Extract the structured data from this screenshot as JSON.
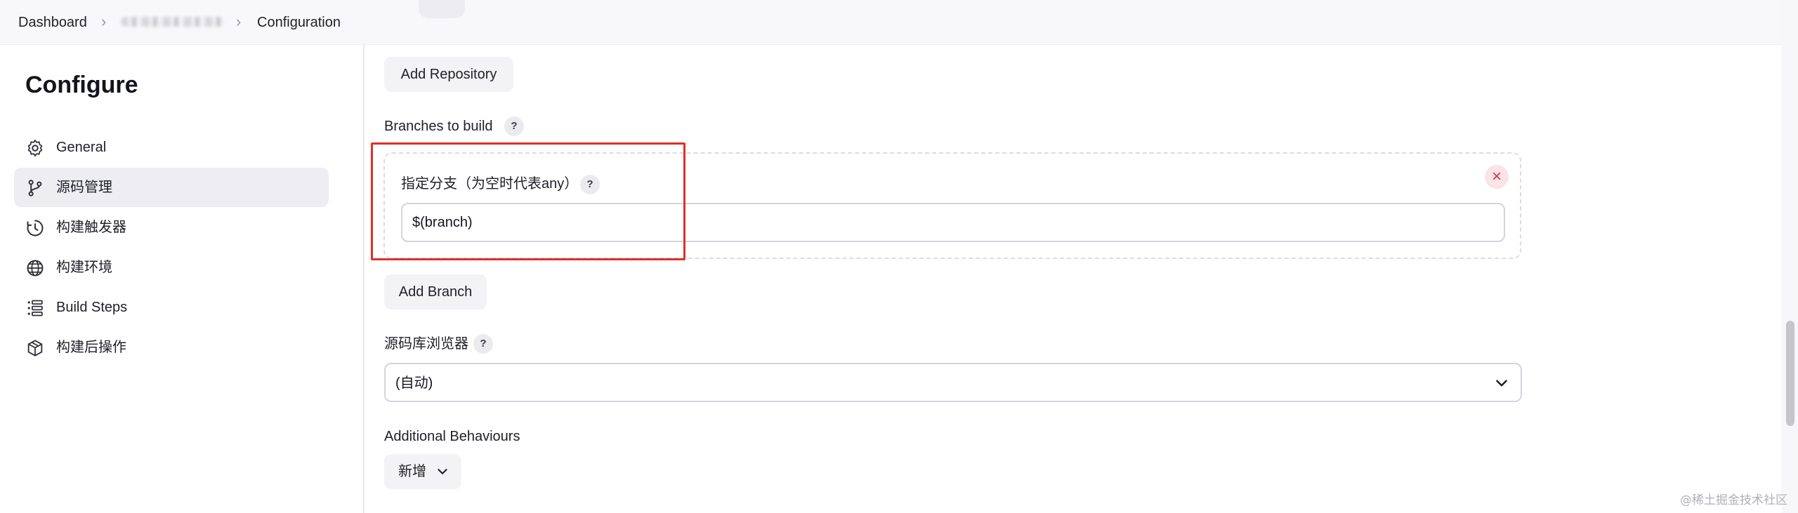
{
  "breadcrumb": {
    "items": [
      "Dashboard",
      "Configuration"
    ],
    "separator": "›"
  },
  "sidebar": {
    "title": "Configure",
    "items": [
      {
        "label": "General",
        "icon": "gear-icon"
      },
      {
        "label": "源码管理",
        "icon": "branch-icon"
      },
      {
        "label": "构建触发器",
        "icon": "clock-icon"
      },
      {
        "label": "构建环境",
        "icon": "globe-icon"
      },
      {
        "label": "Build Steps",
        "icon": "list-icon"
      },
      {
        "label": "构建后操作",
        "icon": "cube-icon"
      }
    ],
    "active_index": 1
  },
  "main": {
    "add_repository": "Add Repository",
    "branches_label": "Branches to build",
    "help_glyph": "?",
    "branch_field_label": "指定分支（为空时代表any）",
    "branch_value": "$(branch)",
    "close_glyph": "×",
    "add_branch": "Add Branch",
    "browser_label": "源码库浏览器",
    "browser_selected": "(自动)",
    "additional_label": "Additional Behaviours",
    "add_new": "新增"
  },
  "colors": {
    "highlight": "#e0302a",
    "active_bg": "#ededf2",
    "close_icon": "#e0304a"
  },
  "watermark": "@稀土掘金技术社区"
}
